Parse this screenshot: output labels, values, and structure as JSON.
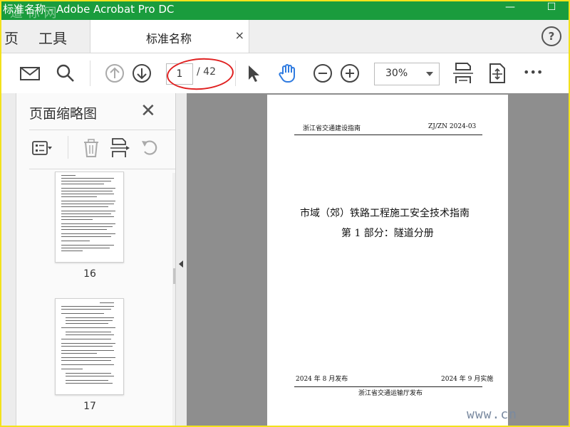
{
  "window": {
    "title": "标准名称 - Adobe Acrobat Pro DC",
    "watermark": "道 标 网",
    "minimize_glyph": "—",
    "maximize_glyph": "☐"
  },
  "menu": {
    "home": "页",
    "tools": "工具"
  },
  "tab": {
    "label": "标准名称",
    "close": "×"
  },
  "help": {
    "label": "?"
  },
  "toolbar": {
    "page_current": "1",
    "page_total": "/ 42",
    "zoom": "30%",
    "more": "•••"
  },
  "panel": {
    "title": "页面缩略图",
    "close": "✕",
    "thumbnails": [
      {
        "page": "16"
      },
      {
        "page": "17"
      }
    ]
  },
  "document": {
    "header_left": "浙江省交通建设指南",
    "header_right": "ZJ/ZN 2024-03",
    "title_line1": "市域（郊）铁路工程施工安全技术指南",
    "title_line2": "第 1 部分：隧道分册",
    "issue_date": "2024 年 8 月发布",
    "effective_date": "2024 年 9 月实施",
    "publisher": "浙江省交通运输厅发布"
  },
  "corner_watermark": "www.cn",
  "colors": {
    "title_bar": "#1a9c3d",
    "hand_tool_active": "#2f7be0",
    "annotation_oval": "#e02020",
    "frame": "#f3e21b"
  }
}
